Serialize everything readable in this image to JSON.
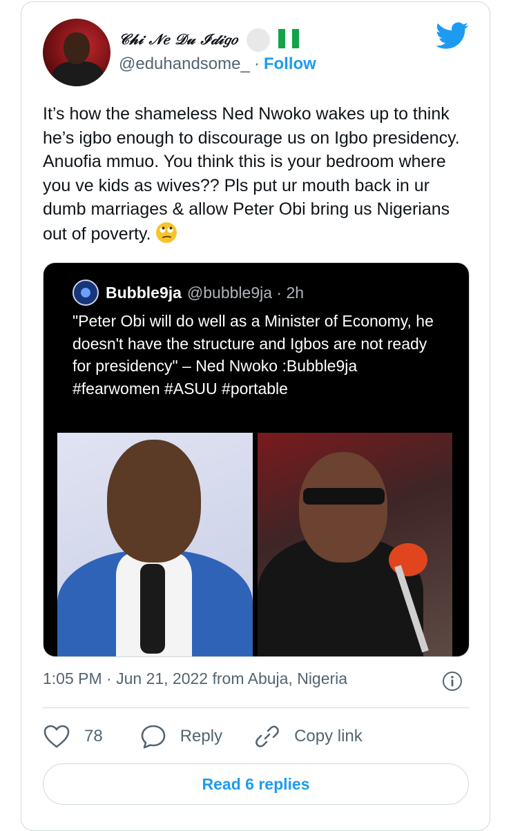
{
  "author": {
    "display_name": "𝒞𝒽𝒾 𝒩𝑒 𝒟𝓊 ℐ𝒹𝒾𝑔𝑜",
    "handle": "@eduhandsome_",
    "separator": "·",
    "follow_label": "Follow"
  },
  "tweet": {
    "text": "It’s how the shameless Ned Nwoko wakes up to think he’s igbo enough to discourage us on Igbo presidency. Anuofia mmuo. You think this is your bedroom where you ve kids as wives??   Pls put ur mouth back in ur dumb marriages & allow Peter Obi bring us Nigerians out of poverty."
  },
  "embedded": {
    "name": "Bubble9ja",
    "meta": "@bubble9ja · 2h",
    "text": "\"Peter Obi will do well as a Minister of Economy, he doesn't have the structure and Igbos are not ready for presidency\" –  Ned Nwoko :Bubble9ja  #fearwomen #ASUU #portable"
  },
  "timestamp": "1:05 PM · Jun 21, 2022 from Abuja, Nigeria",
  "actions": {
    "like_count": "78",
    "reply_label": "Reply",
    "copy_label": "Copy link"
  },
  "read_replies_label": "Read 6 replies",
  "colors": {
    "accent": "#1d9bf0",
    "muted": "#536471",
    "border": "#cfd9de",
    "flag_green": "#13a34a"
  },
  "icons": [
    "twitter-bird-icon",
    "info-icon",
    "heart-icon",
    "speech-bubble-icon",
    "link-icon",
    "face-with-rolling-eyes-emoji"
  ]
}
